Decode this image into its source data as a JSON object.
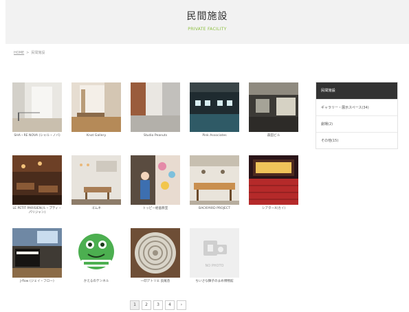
{
  "header": {
    "title": "民間施設",
    "subtitle": "PRIVATE FACILITY"
  },
  "breadcrumb": {
    "home": "HOME",
    "separator": ">",
    "current": "民間施設"
  },
  "facilities": [
    {
      "name": "SHA・RE NOVA (シャル・ノバ)"
    },
    {
      "name": "Knot Gallery"
    },
    {
      "name": "Studio Peanuts"
    },
    {
      "name": "Pink Associates"
    },
    {
      "name": "森田ビル"
    },
    {
      "name": "LE PETIT PARISIEN(ル・プティ・パリジャン)"
    },
    {
      "name": "ゴムネ"
    },
    {
      "name": "トッピー絵画教室"
    },
    {
      "name": "BACKYARD PROJECT"
    },
    {
      "name": "シアターX(カイ)"
    },
    {
      "name": "J-flow (ジェイ・フロー)"
    },
    {
      "name": "かえるのテンネル"
    },
    {
      "name": "一印アトリエ 良尾舎"
    },
    {
      "name": "ちいさな獅子のまめ博物館"
    }
  ],
  "no_photo_label": "NO PHOTO",
  "sidebar": {
    "heading": "民間施設",
    "items": [
      {
        "label": "ギャラリー・展示スペース(34)"
      },
      {
        "label": "劇場(2)"
      },
      {
        "label": "その他(15)"
      }
    ]
  },
  "pagination": {
    "pages": [
      "1",
      "2",
      "3",
      "4"
    ],
    "next": "›",
    "current": "1"
  },
  "colors": {
    "accent_green": "#8cbf3f",
    "sidebar_header_bg": "#333333",
    "header_band_bg": "#f2f2f2"
  }
}
